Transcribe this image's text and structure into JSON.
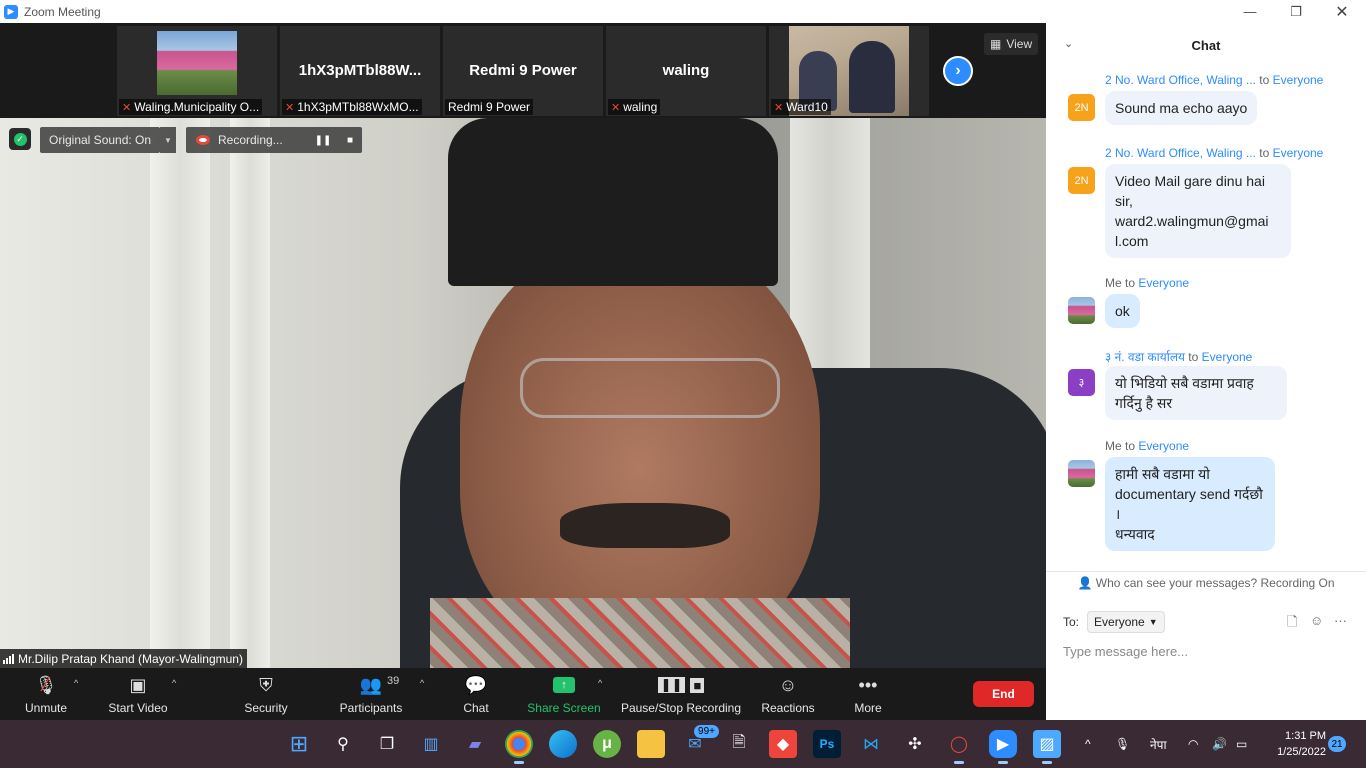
{
  "window": {
    "title": "Zoom Meeting",
    "icon": "zoom-icon",
    "controls": [
      "minimize",
      "restore",
      "close"
    ]
  },
  "thumbnails": [
    {
      "caption": "Waling.Municipality O...",
      "muted": true,
      "type": "picture"
    },
    {
      "big_name": "1hX3pMTbl88W...",
      "caption": "1hX3pMTbl88WxMO...",
      "muted": true,
      "type": "name"
    },
    {
      "big_name": "Redmi 9 Power",
      "caption": "Redmi 9 Power",
      "muted": false,
      "type": "name"
    },
    {
      "big_name": "waling",
      "caption": "waling",
      "muted": true,
      "type": "name"
    },
    {
      "caption": "Ward10",
      "muted": true,
      "type": "video"
    }
  ],
  "view_button": {
    "label": "View",
    "icon": "grid-icon"
  },
  "next_page_icon": "chevron-right-icon",
  "overlays": {
    "original_sound": "Original Sound: On",
    "recording": "Recording..."
  },
  "active_speaker": {
    "name": "Mr.Dilip Pratap Khand (Mayor-Walingmun)"
  },
  "toolbar": {
    "unmute": "Unmute",
    "start_video": "Start Video",
    "security": "Security",
    "participants": "Participants",
    "participants_count": "39",
    "chat": "Chat",
    "share_screen": "Share Screen",
    "pause_stop_recording": "Pause/Stop Recording",
    "reactions": "Reactions",
    "more": "More",
    "end": "End",
    "colors": {
      "share": "#23c26d",
      "end": "#e02828"
    }
  },
  "chat": {
    "title": "Chat",
    "messages": [
      {
        "sender": "2 No. Ward Office, Waling ...",
        "to_word": "to",
        "target": "Everyone",
        "avatar": "2N",
        "text": "Sound ma echo aayo"
      },
      {
        "sender": "2 No. Ward Office, Waling ...",
        "to_word": "to",
        "target": "Everyone",
        "avatar": "2N",
        "text_lines": [
          "Video Mail gare dinu hai",
          "sir,",
          "ward2.walingmun@gmai",
          "l.com"
        ]
      },
      {
        "sender": "Me to",
        "target": "Everyone",
        "avatar": "",
        "text": "ok"
      },
      {
        "sender": "३ नं. वडा कार्यालय",
        "to_word": "to",
        "target": "Everyone",
        "avatar": "३",
        "text_lines": [
          "यो भिडियो सबै वडामा प्रवाह",
          "गर्दिनु है सर"
        ]
      },
      {
        "sender": "Me to",
        "target": "Everyone",
        "avatar": "",
        "text_lines": [
          "हामी सबै वडामा यो",
          "documentary send गर्दछौ ।",
          "धन्यवाद"
        ]
      }
    ],
    "privacy_note": "Who can see your messages? Recording On",
    "to_label": "To:",
    "to_value": "Everyone",
    "input_placeholder": "Type message here..."
  },
  "taskbar": {
    "apps": [
      "windows-start",
      "search",
      "task-view",
      "widgets",
      "teams-chat",
      "chrome",
      "edge",
      "utorrent",
      "file-explorer",
      "mail",
      "notepad",
      "anydesk",
      "photoshop",
      "vscode",
      "slack",
      "opera",
      "zoom",
      "photos"
    ],
    "mail_badge": "99+",
    "language": "नेपा",
    "time": "1:31 PM",
    "date": "1/25/2022",
    "notifications": "21"
  }
}
